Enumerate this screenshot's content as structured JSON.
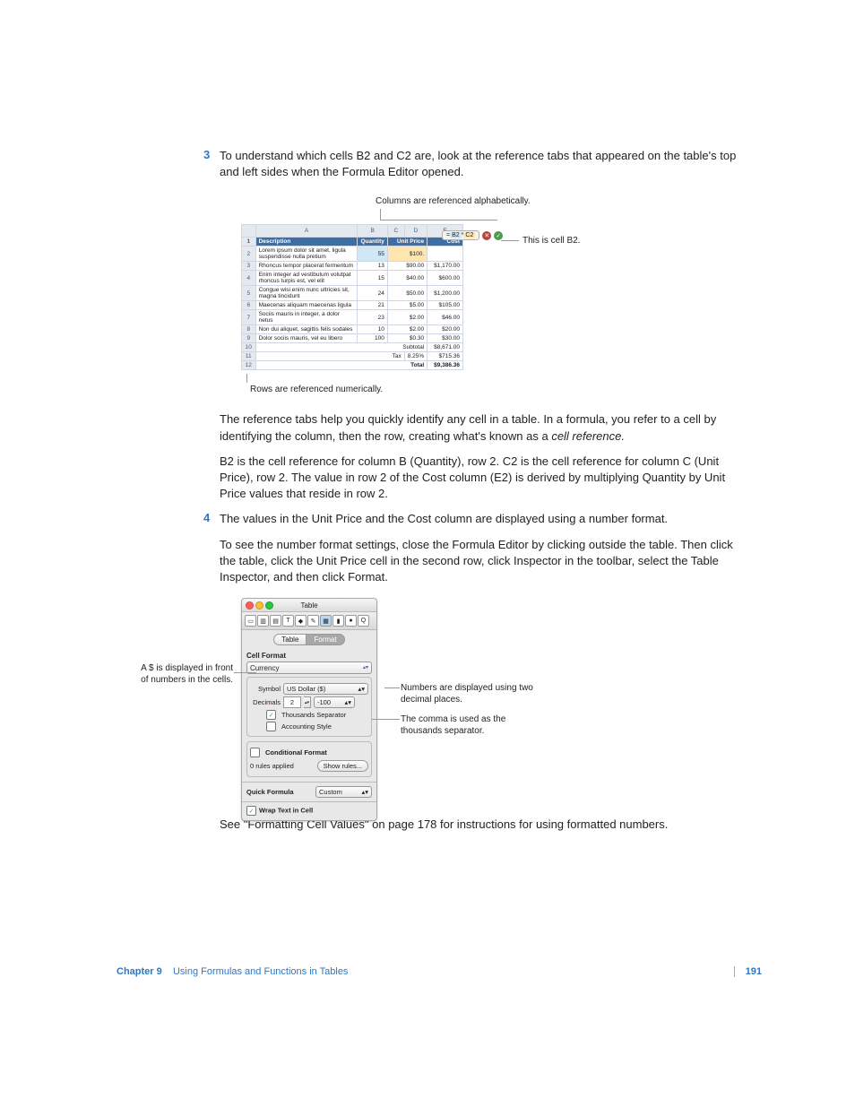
{
  "step3": {
    "num": "3",
    "text": "To understand which cells B2 and C2 are, look at the reference tabs that appeared on the table's top and left sides when the Formula Editor opened."
  },
  "fig1": {
    "caption_top": "Columns are referenced alphabetically.",
    "caption_bottom": "Rows are referenced numerically.",
    "callout_b2": "This is cell B2.",
    "cols": {
      "A": "A",
      "B": "B",
      "C": "C",
      "D": "D",
      "E": "E"
    },
    "hdr": {
      "desc": "Description",
      "qty": "Quantity",
      "unit": "Unit Price",
      "cost": "Cost"
    },
    "rows": [
      {
        "n": "2",
        "desc": "Lorem ipsum dolor sit amet, ligula suspendisse nulla pretium",
        "qty": "55",
        "unit": "$100.",
        "cost": ""
      },
      {
        "n": "3",
        "desc": "Rhoncus tempor placerat fermentum",
        "qty": "13",
        "unit": "$90.00",
        "cost": "$1,170.00"
      },
      {
        "n": "4",
        "desc": "Enim integer ad vestibulum volutpat rhoncus turpis est, vel elit",
        "qty": "15",
        "unit": "$40.00",
        "cost": "$600.00"
      },
      {
        "n": "5",
        "desc": "Congue wisi enim nunc ultricies sit, magna tincidunt",
        "qty": "24",
        "unit": "$50.00",
        "cost": "$1,200.00"
      },
      {
        "n": "6",
        "desc": "Maecenas aliquam maecenas ligula",
        "qty": "21",
        "unit": "$5.00",
        "cost": "$105.00"
      },
      {
        "n": "7",
        "desc": "Sociis mauris in integer, a dolor netus",
        "qty": "23",
        "unit": "$2.00",
        "cost": "$46.00"
      },
      {
        "n": "8",
        "desc": "Non dui aliquet, sagittis felis sodales",
        "qty": "10",
        "unit": "$2.00",
        "cost": "$20.00"
      },
      {
        "n": "9",
        "desc": "Dolor sociis mauris, vel eu libero",
        "qty": "100",
        "unit": "$0.30",
        "cost": "$30.00"
      }
    ],
    "foot": [
      {
        "n": "10",
        "lbl": "Subtotal",
        "val": "$8,671.00"
      },
      {
        "n": "11",
        "lbl": "Tax",
        "pct": "8.25%",
        "val": "$715.36"
      },
      {
        "n": "12",
        "lbl": "Total",
        "val": "$9,386.36"
      }
    ],
    "formula": {
      "eq": "=",
      "b": "B2",
      "star": "*",
      "c": "C2"
    }
  },
  "p_ref": "The reference tabs help you quickly identify any cell in a table. In a formula, you refer to a cell by identifying the column, then the row, creating what's known as a ",
  "p_ref_em": "cell reference.",
  "p_b2": "B2 is the cell reference for column B (Quantity), row 2. C2 is the cell reference for column C (Unit Price), row 2. The value in row 2 of the Cost column (E2) is derived by multiplying Quantity by Unit Price values that reside in row 2.",
  "step4": {
    "num": "4",
    "text": "The values in the Unit Price and the Cost column are displayed using a number format."
  },
  "p_tosee": "To see the number format settings, close the Formula Editor by clicking outside the table. Then click the table, click the Unit Price cell in the second row, click Inspector in the toolbar, select the Table Inspector, and then click Format.",
  "anno": {
    "left": "A $ is displayed in front of numbers in the cells.",
    "r1": "Numbers are displayed using two decimal places.",
    "r2": "The comma is used as the thousands separator."
  },
  "inspector": {
    "title": "Table",
    "tabs": {
      "table": "Table",
      "format": "Format"
    },
    "cellformat_lbl": "Cell Format",
    "cellformat_val": "Currency",
    "symbol_lbl": "Symbol",
    "symbol_val": "US Dollar ($)",
    "decimals_lbl": "Decimals",
    "decimals_val": "2",
    "neg_val": "-100",
    "thousands": "Thousands Separator",
    "accounting": "Accounting Style",
    "cond_lbl": "Conditional Format",
    "rules": "0 rules applied",
    "showrules": "Show rules...",
    "quick_lbl": "Quick Formula",
    "quick_val": "Custom",
    "wrap": "Wrap Text in Cell"
  },
  "p_see": "See \"Formatting Cell Values\" on page 178 for instructions for using formatted numbers.",
  "footer": {
    "chapter_bold": "Chapter 9",
    "chapter_title": "Using Formulas and Functions in Tables",
    "page": "191"
  }
}
